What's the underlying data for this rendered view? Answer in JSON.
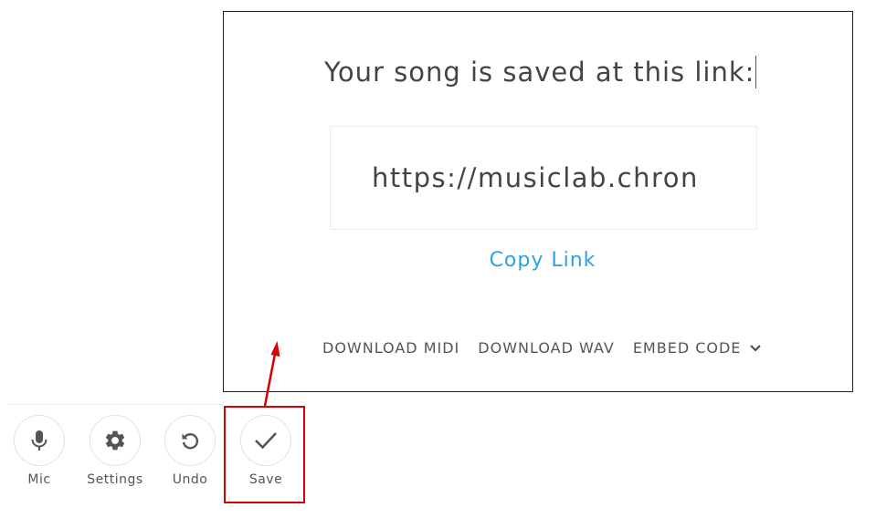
{
  "dialog": {
    "title": "Your song is saved at this link:",
    "link_value": "https://musiclab.chron",
    "copy_link_label": "Copy Link",
    "download_midi_label": "DOWNLOAD MIDI",
    "download_wav_label": "DOWNLOAD WAV",
    "embed_code_label": "EMBED CODE",
    "embed_icon": "chevron-down-icon",
    "link_color": "#2ba3e3"
  },
  "toolbar": {
    "items": [
      {
        "label": "Mic",
        "icon": "mic-icon"
      },
      {
        "label": "Settings",
        "icon": "gear-icon"
      },
      {
        "label": "Undo",
        "icon": "undo-icon"
      },
      {
        "label": "Save",
        "icon": "check-icon"
      }
    ]
  },
  "annotation": {
    "highlight_color": "#d80000"
  }
}
